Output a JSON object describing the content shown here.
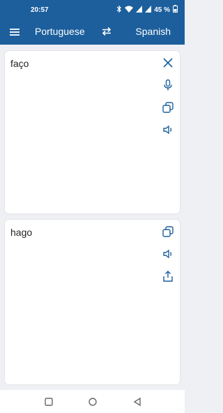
{
  "status_bar": {
    "time": "20:57",
    "battery_text": "45 %",
    "icons": [
      "bluetooth-icon",
      "wifi-icon",
      "signal-icon",
      "signal-icon",
      "battery-icon"
    ]
  },
  "toolbar": {
    "source_language": "Portuguese",
    "target_language": "Spanish",
    "menu_icon": "menu-icon",
    "swap_icon": "swap-icon"
  },
  "input_card": {
    "text": "faço",
    "actions": [
      "close-icon",
      "mic-icon",
      "copy-icon",
      "speaker-icon"
    ]
  },
  "output_card": {
    "text": "hago",
    "actions": [
      "copy-icon",
      "speaker-icon",
      "share-icon"
    ]
  },
  "colors": {
    "primary": "#1c5f9c",
    "accent": "#1c5f9c",
    "background": "#eef0f3"
  }
}
